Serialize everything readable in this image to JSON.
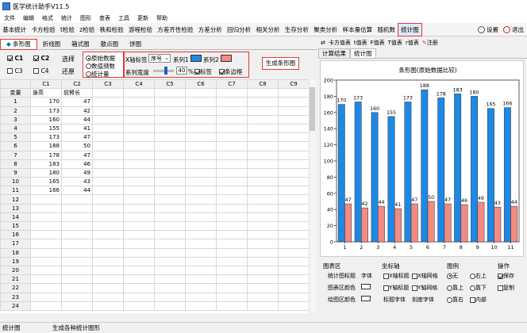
{
  "window": {
    "title": "医学统计助手V11.5"
  },
  "menu": [
    "文件",
    "编辑",
    "格式",
    "统计",
    "图形",
    "查表",
    "工具",
    "更新",
    "帮助"
  ],
  "toolbar": {
    "items": [
      "基本统计",
      "卡方检验",
      "t检验",
      "z检验",
      "秩和检验",
      "游程检验",
      "方差齐性检验",
      "方差分析",
      "回归分析",
      "相关分析",
      "生存分析",
      "聚类分析",
      "样本量估算",
      "随机数",
      "统计图"
    ],
    "active": "统计图",
    "settings": "设置",
    "exit": "退出"
  },
  "chart_tabs": {
    "items": [
      "条形图",
      "折线图",
      "箱式图",
      "散点图",
      "饼图"
    ],
    "active": "条形图"
  },
  "controls": {
    "c1": "C1",
    "c2": "C2",
    "c3": "C3",
    "c4": "C4",
    "select_label": "选择",
    "restore_label": "还原",
    "data_source": [
      "原始数据",
      "数值频数",
      "统计量"
    ],
    "x_label_title": "X轴标签",
    "x_label_value": "序号",
    "series1": "系列1",
    "series2": "系列2",
    "series1_color": "#1e88e5",
    "series2_color": "#f28b82",
    "width_label": "系列宽度",
    "width_value": "40",
    "width_unit": "%",
    "tag_label": "标签",
    "border_label": "条边框",
    "generate": "生成条形图"
  },
  "grid": {
    "columns": [
      "C1",
      "C2",
      "C3",
      "C4",
      "C5",
      "C6",
      "C7",
      "C8",
      "C9"
    ],
    "header_row": {
      "label": "变量",
      "c1": "身高",
      "c2": "前臂长"
    },
    "rows": [
      [
        "1",
        "170",
        "47"
      ],
      [
        "2",
        "173",
        "42"
      ],
      [
        "3",
        "160",
        "44"
      ],
      [
        "4",
        "155",
        "41"
      ],
      [
        "5",
        "173",
        "47"
      ],
      [
        "6",
        "188",
        "50"
      ],
      [
        "7",
        "178",
        "47"
      ],
      [
        "8",
        "183",
        "46"
      ],
      [
        "9",
        "180",
        "49"
      ],
      [
        "10",
        "165",
        "43"
      ],
      [
        "11",
        "166",
        "44"
      ],
      [
        "12",
        "",
        ""
      ],
      [
        "13",
        "",
        ""
      ],
      [
        "14",
        "",
        ""
      ],
      [
        "15",
        "",
        ""
      ],
      [
        "16",
        "",
        ""
      ],
      [
        "17",
        "",
        ""
      ],
      [
        "18",
        "",
        ""
      ],
      [
        "19",
        "",
        ""
      ],
      [
        "20",
        "",
        ""
      ],
      [
        "21",
        "",
        ""
      ],
      [
        "22",
        "",
        ""
      ],
      [
        "23",
        "",
        ""
      ],
      [
        "24",
        "",
        ""
      ]
    ]
  },
  "right_panel": {
    "tabs1": [
      "卡方值表",
      "t值表",
      "F值表",
      "T值表",
      "r值表",
      "注册"
    ],
    "tabs2": [
      "计算结果",
      "统计图"
    ],
    "active_tab2": "统计图"
  },
  "chart_data": {
    "type": "bar",
    "title": "条形图(原始数据比较)",
    "categories": [
      "1",
      "2",
      "3",
      "4",
      "5",
      "6",
      "7",
      "8",
      "9",
      "10",
      "11"
    ],
    "series": [
      {
        "name": "",
        "color": "#1e88e5",
        "values": [
          170,
          173,
          160,
          155,
          173,
          188,
          178,
          183,
          180,
          165,
          166
        ]
      },
      {
        "name": "",
        "color": "#f28b82",
        "values": [
          47,
          42,
          44,
          41,
          47,
          50,
          47,
          46,
          49,
          43,
          44
        ]
      }
    ],
    "ylim": [
      0,
      200
    ],
    "yticks": [
      0,
      20,
      40,
      60,
      80,
      100,
      120,
      140,
      160,
      180,
      200
    ]
  },
  "options": {
    "chart_area": {
      "title": "图表区",
      "stat_title": "统计图标题",
      "font": "字体",
      "area_color": "图表区颜色",
      "plot_color": "绘图区颜色"
    },
    "axis": {
      "title": "坐标轴",
      "x_title": "X轴标题",
      "x_grid": "X轴网格",
      "y_title": "Y轴标题",
      "y_grid": "Y轴网格",
      "title_font": "标题字体",
      "tick_font": "刻度字体"
    },
    "legend": {
      "title": "图例",
      "none": "无",
      "top_right": "右上",
      "top_left": "靠上",
      "bottom": "靠下",
      "right": "靠右",
      "inside": "内部"
    },
    "ops": {
      "title": "操作",
      "save": "保存",
      "copy": "复制"
    }
  },
  "status": {
    "left": "统计图",
    "right": "生成各种统计图形"
  }
}
